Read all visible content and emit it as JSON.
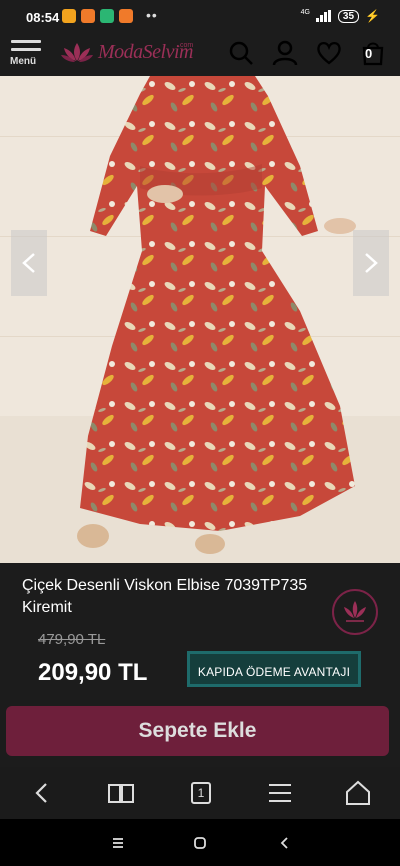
{
  "status_bar": {
    "time": "08:54",
    "network": "4G",
    "battery": "35"
  },
  "header": {
    "menu_label": "Menü",
    "logo_text": "ModaSelvim",
    "logo_suffix": ".com",
    "cart_count": "0"
  },
  "product": {
    "title": "Çiçek Desenli Viskon Elbise 7039TP735 Kiremit",
    "old_price": "479,90 TL",
    "price": "209,90 TL",
    "cod_badge": "KAPIDA ÖDEME AVANTAJI"
  },
  "actions": {
    "add_to_cart": "Sepete Ekle"
  },
  "browser": {
    "tab_count": "1"
  },
  "colors": {
    "dress": "#c7483a",
    "brand": "#9b2f57",
    "button": "#6e1f3b",
    "badge": "#1e6b6b"
  }
}
